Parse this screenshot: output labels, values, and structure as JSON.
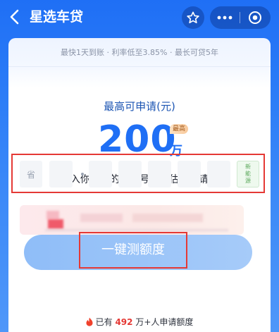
{
  "header": {
    "title": "星选车贷",
    "back_icon": "chevron-left-icon",
    "favorite_icon": "star-outline-icon",
    "more_icon": "more-horizontal-icon",
    "close_icon": "target-circle-icon"
  },
  "card": {
    "tagline": "最快1天到账 · 利率低至3.85% · 最长可贷5年",
    "max_label": "最高可申请(元)",
    "amount": "200",
    "unit": "万",
    "badge": "最高",
    "prompt": "请输入你名下的车牌号，预估可申请额度"
  },
  "plate_input": {
    "province_placeholder": "省",
    "new_energy_label_1": "新",
    "new_energy_label_2": "能",
    "new_energy_label_3": "源"
  },
  "cta": {
    "label": "一键测额度"
  },
  "footer": {
    "prefix": "已有",
    "count": "492",
    "suffix": "万+人申请额度"
  },
  "colors": {
    "accent": "#1f6ff5",
    "highlight_border": "#e53935",
    "count": "#e53935"
  }
}
